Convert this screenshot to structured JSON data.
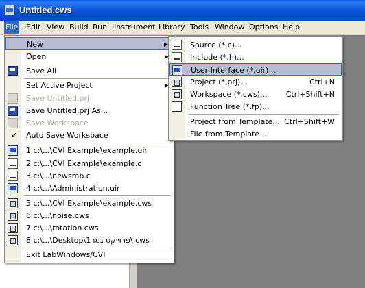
{
  "window": {
    "title": "Untitled.cws"
  },
  "menubar": {
    "items": [
      "File",
      "Edit",
      "View",
      "Build",
      "Run",
      "Instrument",
      "Library",
      "Tools",
      "Window",
      "Options",
      "Help"
    ]
  },
  "file_menu": {
    "new": "New",
    "open": "Open",
    "save_all": "Save All",
    "set_active_project": "Set Active Project",
    "save_untitled_prj": "Save Untitled.prj",
    "save_untitled_prj_as": "Save Untitled.prj As...",
    "save_workspace": "Save Workspace",
    "auto_save_workspace": "Auto Save Workspace",
    "recent": [
      "1 c:\\...\\CVI Example\\example.uir",
      "2 c:\\...\\CVI Example\\example.c",
      "3 c:\\...\\newsmb.c",
      "4 c:\\...\\Administration.uir",
      "5 c:\\...\\CVI Example\\example.cws",
      "6 c:\\...\\noise.cws",
      "7 c:\\...\\rotation.cws",
      "8 c:\\...\\Desktop\\פרוייקט גמר1\\.cws"
    ],
    "exit": "Exit LabWindows/CVI"
  },
  "new_submenu": {
    "source": "Source (*.c)...",
    "include": "Include (*.h)...",
    "user_interface": "User Interface (*.uir)...",
    "project": "Project (*.prj)...",
    "project_sc": "Ctrl+N",
    "workspace": "Workspace (*.cws)...",
    "workspace_sc": "Ctrl+Shift+N",
    "function_tree": "Function Tree (*.fp)...",
    "project_from_template": "Project from Template...",
    "project_from_template_sc": "Ctrl+Shift+W",
    "file_from_template": "File from Template..."
  }
}
